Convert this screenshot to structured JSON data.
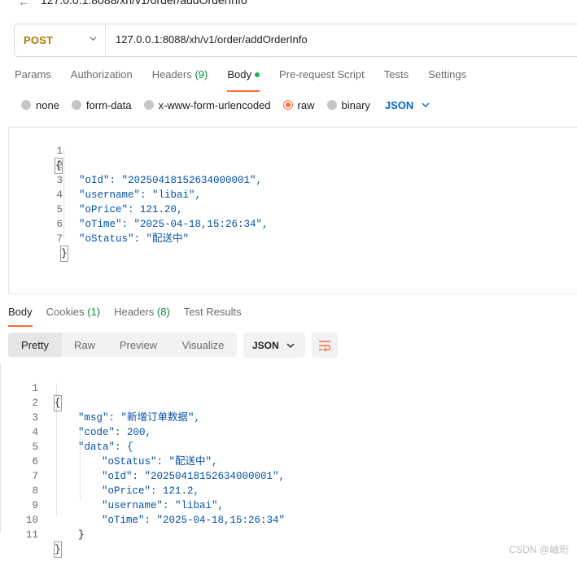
{
  "header": {
    "back_icon": "arrow-left-icon",
    "crumb": "127.0.0.1:8088/xh/v1/order/addOrderInfo"
  },
  "request": {
    "method": "POST",
    "method_color": "#ad7a03",
    "url": "127.0.0.1:8088/xh/v1/order/addOrderInfo"
  },
  "request_tabs": [
    {
      "label": "Params",
      "count": ""
    },
    {
      "label": "Authorization",
      "count": ""
    },
    {
      "label": "Headers",
      "count": "(9)"
    },
    {
      "label": "Body",
      "count": "",
      "active": true
    },
    {
      "label": "Pre-request Script",
      "count": ""
    },
    {
      "label": "Tests",
      "count": ""
    },
    {
      "label": "Settings",
      "count": ""
    }
  ],
  "body_types": [
    {
      "label": "none",
      "selected": false
    },
    {
      "label": "form-data",
      "selected": false
    },
    {
      "label": "x-www-form-urlencoded",
      "selected": false
    },
    {
      "label": "raw",
      "selected": true
    },
    {
      "label": "binary",
      "selected": false
    }
  ],
  "body_language": "JSON",
  "request_body_lines": [
    {
      "n": "1",
      "text": "{"
    },
    {
      "n": "2",
      "text": "\"oId\": \"20250418152634000001\","
    },
    {
      "n": "3",
      "text": "\"username\": \"libai\","
    },
    {
      "n": "4",
      "text": "\"oPrice\": 121.20,"
    },
    {
      "n": "5",
      "text": "\"oTime\": \"2025-04-18,15:26:34\","
    },
    {
      "n": "6",
      "text": "\"oStatus\": \"配送中\""
    },
    {
      "n": "7",
      "text": "}"
    }
  ],
  "response_tabs": [
    {
      "label": "Body",
      "count": "",
      "active": true
    },
    {
      "label": "Cookies",
      "count": "(1)"
    },
    {
      "label": "Headers",
      "count": "(8)"
    },
    {
      "label": "Test Results",
      "count": ""
    }
  ],
  "view_modes": [
    "Pretty",
    "Raw",
    "Preview",
    "Visualize"
  ],
  "view_mode_active": "Pretty",
  "response_format": "JSON",
  "response_body_lines": [
    {
      "n": "1",
      "text": "{"
    },
    {
      "n": "2",
      "text": "\"msg\": \"新增订单数据\","
    },
    {
      "n": "3",
      "text": "\"code\": 200,"
    },
    {
      "n": "4",
      "text": "\"data\": {"
    },
    {
      "n": "5",
      "text": "\"oStatus\": \"配送中\","
    },
    {
      "n": "6",
      "text": "\"oId\": \"20250418152634000001\","
    },
    {
      "n": "7",
      "text": "\"oPrice\": 121.2,"
    },
    {
      "n": "8",
      "text": "\"username\": \"libai\","
    },
    {
      "n": "9",
      "text": "\"oTime\": \"2025-04-18,15:26:34\""
    },
    {
      "n": "10",
      "text": "}"
    },
    {
      "n": "11",
      "text": "}"
    }
  ],
  "watermark": "CSDN @岫珩",
  "colors": {
    "accent": "#ff6c37",
    "link": "#0265d2",
    "count": "#0a8a3c",
    "active_dot": "#0cbb52"
  }
}
